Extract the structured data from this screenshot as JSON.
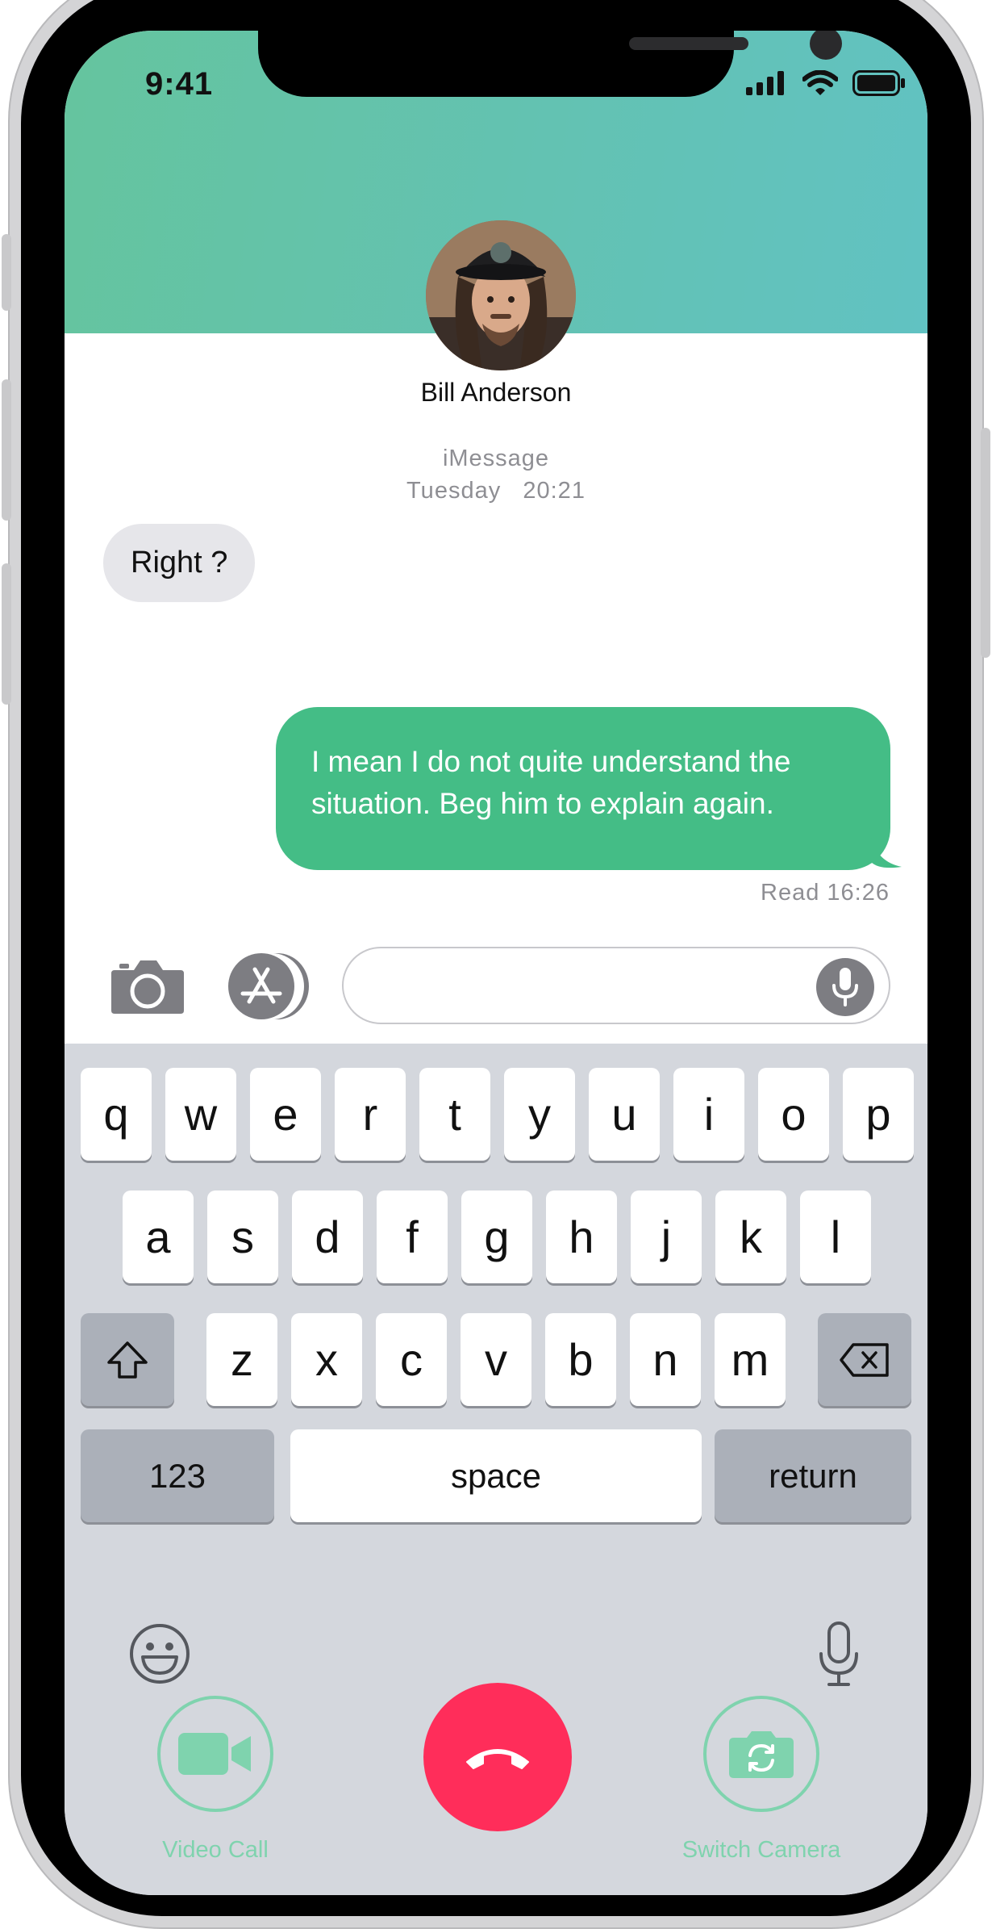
{
  "status_bar": {
    "time": "9:41"
  },
  "contact": {
    "name": "Bill Anderson"
  },
  "thread": {
    "service": "iMessage",
    "date": "Tuesday   20:21",
    "messages": [
      {
        "direction": "incoming",
        "text": "Right ?"
      },
      {
        "direction": "outgoing",
        "lines": [
          "I mean I do not quite understand the",
          "situation. Beg him to explain again."
        ]
      }
    ],
    "read_receipt": "Read 16:26"
  },
  "input": {
    "placeholder": ""
  },
  "keyboard": {
    "row1": [
      "q",
      "w",
      "e",
      "r",
      "t",
      "y",
      "u",
      "i",
      "o",
      "p"
    ],
    "row2": [
      "a",
      "s",
      "d",
      "f",
      "g",
      "h",
      "j",
      "k",
      "l"
    ],
    "row3": [
      "z",
      "x",
      "c",
      "v",
      "b",
      "n",
      "m"
    ],
    "numbers_label": "123",
    "space_label": "space",
    "return_label": "return"
  },
  "call_controls": {
    "video_label": "Video Call",
    "switch_label": "Switch Camera"
  },
  "colors": {
    "accent_green": "#44bd86",
    "header_gradient_start": "#65c49e",
    "header_gradient_end": "#61c2c2",
    "end_call_red": "#ff2d5a"
  },
  "icons": [
    "camera-icon",
    "app-store-icon",
    "microphone-icon",
    "shift-icon",
    "backspace-icon",
    "emoji-icon",
    "dictation-icon",
    "video-camera-icon",
    "end-call-icon",
    "switch-camera-icon",
    "signal-icon",
    "wifi-icon",
    "battery-icon"
  ]
}
